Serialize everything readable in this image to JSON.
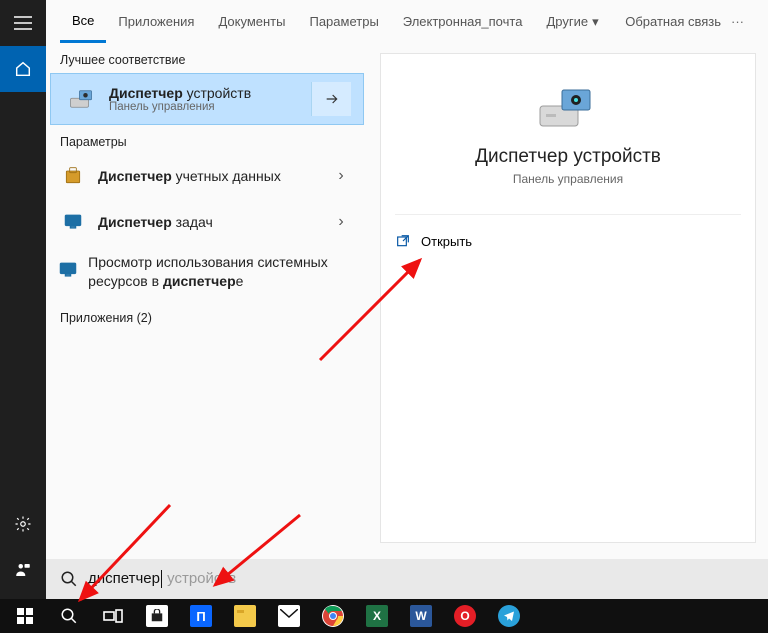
{
  "tabs": {
    "items": [
      "Все",
      "Приложения",
      "Документы",
      "Параметры",
      "Электронная_почта",
      "Другие"
    ],
    "active_index": 0,
    "feedback": "Обратная связь"
  },
  "sections": {
    "best_match": "Лучшее соответствие",
    "settings": "Параметры",
    "apps": "Приложения (2)"
  },
  "best": {
    "title_bold": "Диспетчер",
    "title_rest": " устройств",
    "sub": "Панель управления"
  },
  "results": [
    {
      "title_bold": "Диспетчер",
      "title_rest": " учетных данных",
      "icon": "credential-icon"
    },
    {
      "title_bold": "Диспетчер",
      "title_rest": " задач",
      "icon": "monitor-icon"
    },
    {
      "title_plain_pre": "Просмотр использования системных ресурсов в ",
      "title_bold": "диспетчер",
      "title_plain_post": "е",
      "icon": "monitor-icon",
      "no_chevron": true
    }
  ],
  "preview": {
    "title": "Диспетчер устройств",
    "sub": "Панель управления",
    "open": "Открыть"
  },
  "search": {
    "typed": "диспетчер",
    "ghost": " устройств"
  }
}
